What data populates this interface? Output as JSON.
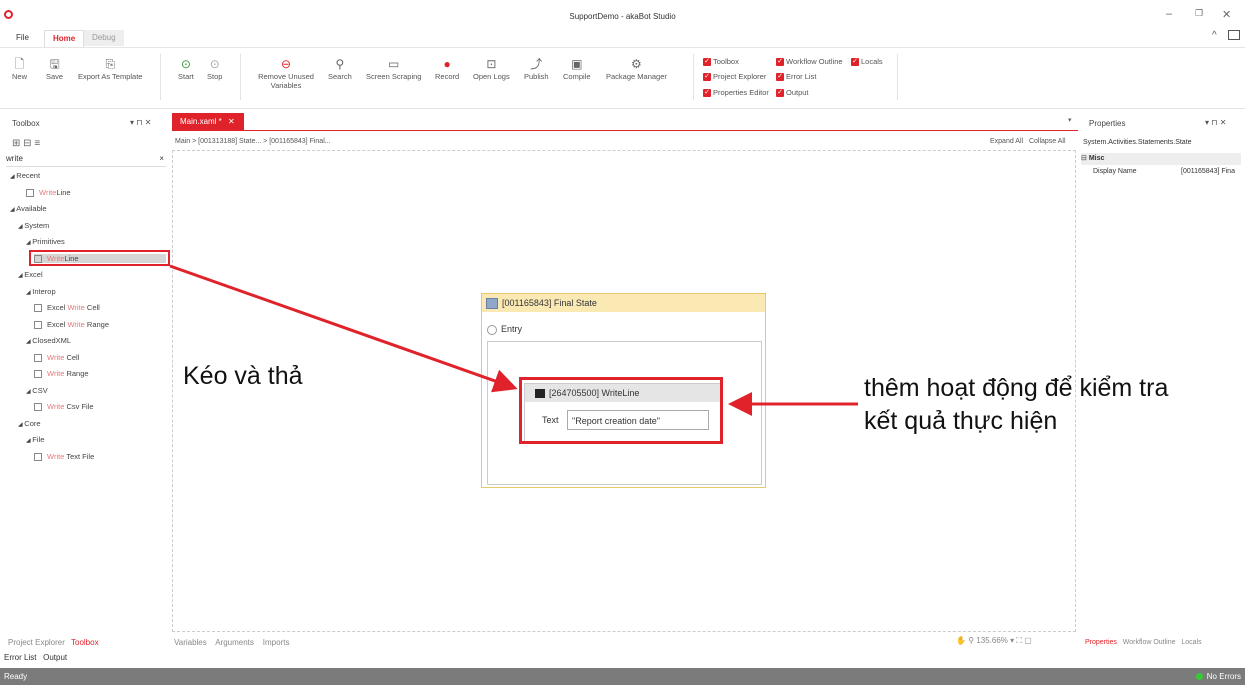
{
  "window": {
    "title": "SupportDemo - akaBot Studio"
  },
  "menu_tabs": [
    "File",
    "Home",
    "Debug"
  ],
  "ribbon": {
    "file_group": [
      "New",
      "Save",
      "Export As Template"
    ],
    "run_group": [
      "Start",
      "Stop"
    ],
    "tools_group": [
      "Remove Unused Variables",
      "Search",
      "Screen Scraping",
      "Record",
      "Open Logs",
      "Publish",
      "Compile",
      "Package Manager"
    ],
    "panel_toggles": [
      "Toolbox",
      "Workflow Outline",
      "Locals",
      "Project Explorer",
      "Error List",
      "Properties Editor",
      "Output"
    ]
  },
  "toolbox": {
    "title": "Toolbox",
    "search_value": "write",
    "tree": [
      {
        "indent": 0,
        "label": "Recent",
        "kind": "group"
      },
      {
        "indent": 2,
        "pre": "",
        "hl": "Write",
        "post": "Line",
        "kind": "item"
      },
      {
        "indent": 0,
        "label": "Available",
        "kind": "group"
      },
      {
        "indent": 1,
        "label": "System",
        "kind": "group"
      },
      {
        "indent": 2,
        "label": "Primitives",
        "kind": "group"
      },
      {
        "indent": 3,
        "pre": "",
        "hl": "Write",
        "post": "Line",
        "kind": "item",
        "selected": true
      },
      {
        "indent": 1,
        "label": "Excel",
        "kind": "group"
      },
      {
        "indent": 2,
        "label": "Interop",
        "kind": "group"
      },
      {
        "indent": 3,
        "pre": "Excel ",
        "hl": "Write",
        "post": " Cell",
        "kind": "item"
      },
      {
        "indent": 3,
        "pre": "Excel ",
        "hl": "Write",
        "post": " Range",
        "kind": "item"
      },
      {
        "indent": 2,
        "label": "ClosedXML",
        "kind": "group"
      },
      {
        "indent": 3,
        "pre": "",
        "hl": "Write",
        "post": " Cell",
        "kind": "item"
      },
      {
        "indent": 3,
        "pre": "",
        "hl": "Write",
        "post": " Range",
        "kind": "item"
      },
      {
        "indent": 2,
        "label": "CSV",
        "kind": "group"
      },
      {
        "indent": 3,
        "pre": "",
        "hl": "Write",
        "post": " Csv File",
        "kind": "item"
      },
      {
        "indent": 1,
        "label": "Core",
        "kind": "group"
      },
      {
        "indent": 2,
        "label": "File",
        "kind": "group"
      },
      {
        "indent": 3,
        "pre": "",
        "hl": "Write",
        "post": " Text File",
        "kind": "item"
      }
    ],
    "bottom_tabs": [
      "Project Explorer",
      "Toolbox"
    ]
  },
  "designer": {
    "doc_tab": "Main.xaml *",
    "breadcrumb": [
      "Main",
      "[001313188] State...",
      "[001165843] Final..."
    ],
    "expand_all": "Expand All",
    "collapse_all": "Collapse All",
    "state_title": "[001165843] Final State",
    "entry_label": "Entry",
    "activity_title": "[264705500] WriteLine",
    "text_label": "Text",
    "text_value": "\"Report creation date\"",
    "bottom_tabs": [
      "Variables",
      "Arguments",
      "Imports"
    ],
    "zoom": "135.66%"
  },
  "properties": {
    "title": "Properties",
    "type_name": "System.Activities.Statements.State",
    "category": "Misc",
    "rows": [
      {
        "name": "Display Name",
        "value": "[001165843] Fina"
      }
    ],
    "bottom_tabs": [
      "Properties",
      "Workflow Outline",
      "Locals"
    ]
  },
  "bottom_tabs": [
    "Error List",
    "Output"
  ],
  "status": {
    "left": "Ready",
    "right": "No Errors"
  },
  "annotations": {
    "drag": "Kéo và thả",
    "add_line1": "thêm hoạt động để kiểm tra",
    "add_line2": "kết quả thực hiện"
  }
}
